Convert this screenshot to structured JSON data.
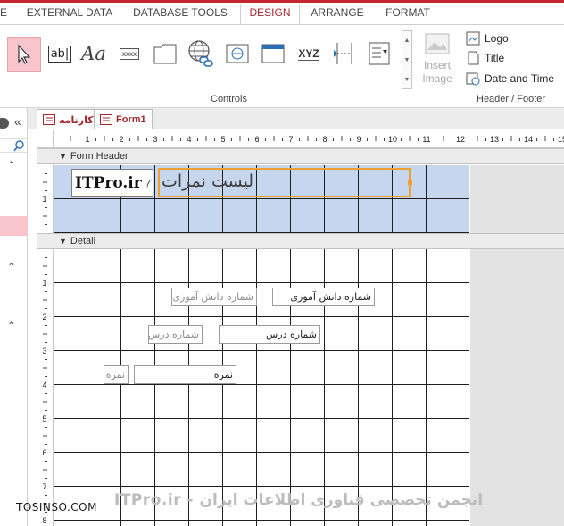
{
  "ribbon_tabs": [
    {
      "label": "E",
      "active": false
    },
    {
      "label": "EXTERNAL DATA",
      "active": false
    },
    {
      "label": "DATABASE TOOLS",
      "active": false
    },
    {
      "label": "DESIGN",
      "active": true
    },
    {
      "label": "ARRANGE",
      "active": false
    },
    {
      "label": "FORMAT",
      "active": false
    }
  ],
  "controls": {
    "group_label": "Controls",
    "textbox_glyph": "ab|",
    "label_glyph": "Aa",
    "button_glyph": "xxxx",
    "option_group_glyph": "XYZ",
    "insert_image_line1": "Insert",
    "insert_image_line2": "Image"
  },
  "header_footer": {
    "group_label": "Header / Footer",
    "logo_label": "Logo",
    "title_label": "Title",
    "date_time_label": "Date and Time"
  },
  "document_tabs": [
    {
      "label": "کارنامه"
    },
    {
      "label": "Form1"
    }
  ],
  "ruler": {
    "ticks": [
      "1",
      "2",
      "3",
      "4",
      "5",
      "6",
      "7",
      "8",
      "9",
      "10",
      "11",
      "12",
      "13",
      "14",
      "15"
    ],
    "vertical_header": [
      "1"
    ],
    "vertical_detail": [
      "1",
      "2",
      "3",
      "4",
      "5",
      "6",
      "7",
      "8"
    ]
  },
  "sections": {
    "form_header_label": "Form Header",
    "detail_label": "Detail"
  },
  "form_header": {
    "logo_text": "ITPro.ir",
    "title_text": "لیست نمرات"
  },
  "detail_fields": [
    {
      "label": "شماره دانش آموزی",
      "field": "شماره دانش آموزی"
    },
    {
      "label": "شماره درس",
      "field": "شماره درس"
    },
    {
      "label": "نمره",
      "field": "نمره"
    }
  ],
  "watermark": {
    "line": "ITPro.ir - انجمن تخصصی فناوری اطلاعات ایران",
    "site": "TOSINSO.COM"
  },
  "colors": {
    "accent": "#a4262c",
    "selected_control": "#f7c5cb",
    "header_grid_fill": "#c7d6ef",
    "title_border": "#f0a030"
  }
}
